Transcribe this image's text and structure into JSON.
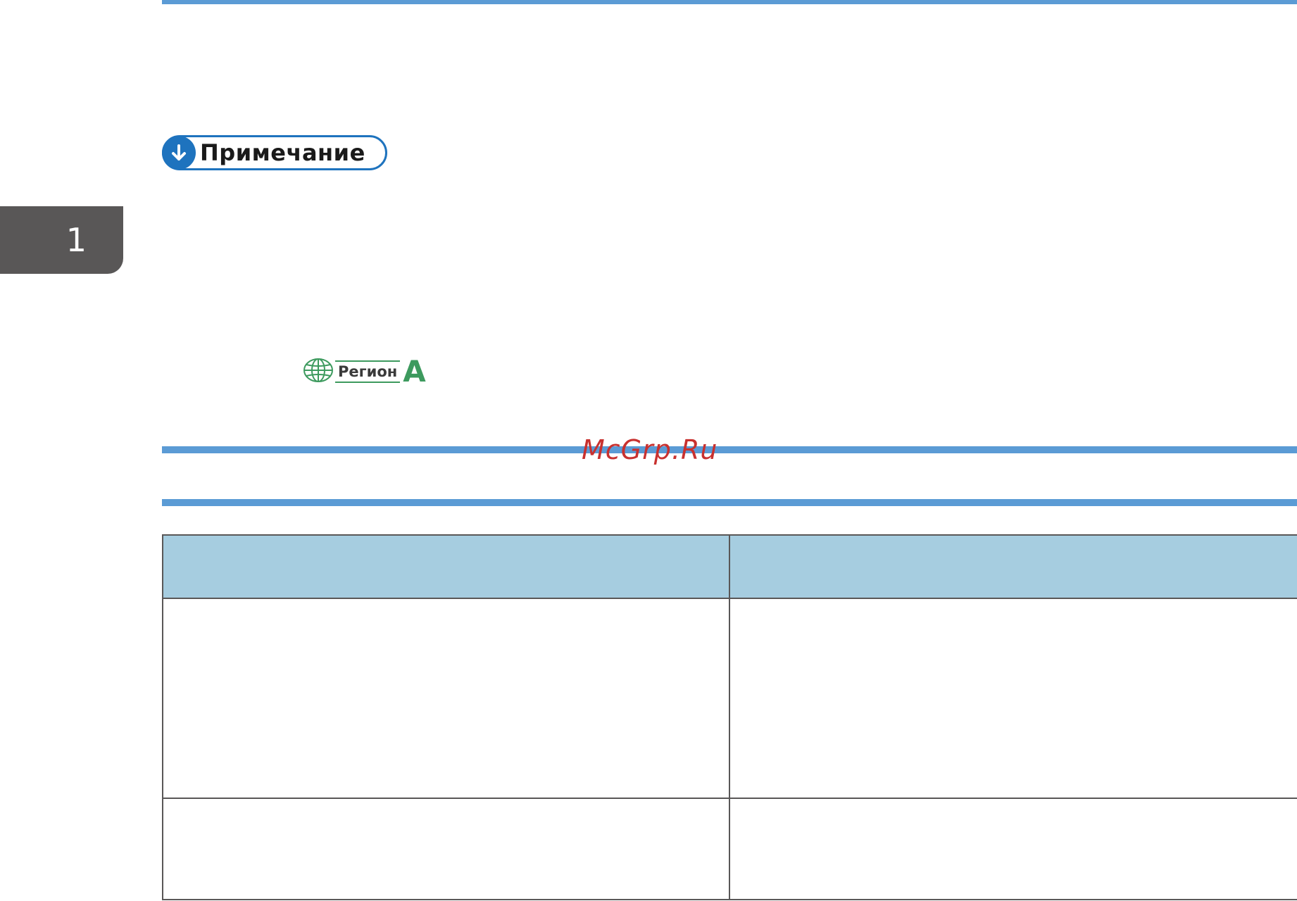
{
  "note": {
    "label": "Примечание",
    "icon": "down-arrow-icon",
    "accent_color": "#1e73be"
  },
  "chapter_tab": {
    "number": "1",
    "color": "#595757"
  },
  "region_badge": {
    "label": "Регион",
    "letter": "A",
    "icon": "globe-icon",
    "color": "#3d9a5e"
  },
  "watermark": {
    "text": "McGrp.Ru",
    "color": "#c8312f"
  },
  "rule_color": "#5b9bd5",
  "table": {
    "header_color": "#a6cde0",
    "headers": [
      "",
      ""
    ],
    "rows": [
      [
        "",
        ""
      ],
      [
        "",
        ""
      ]
    ]
  }
}
